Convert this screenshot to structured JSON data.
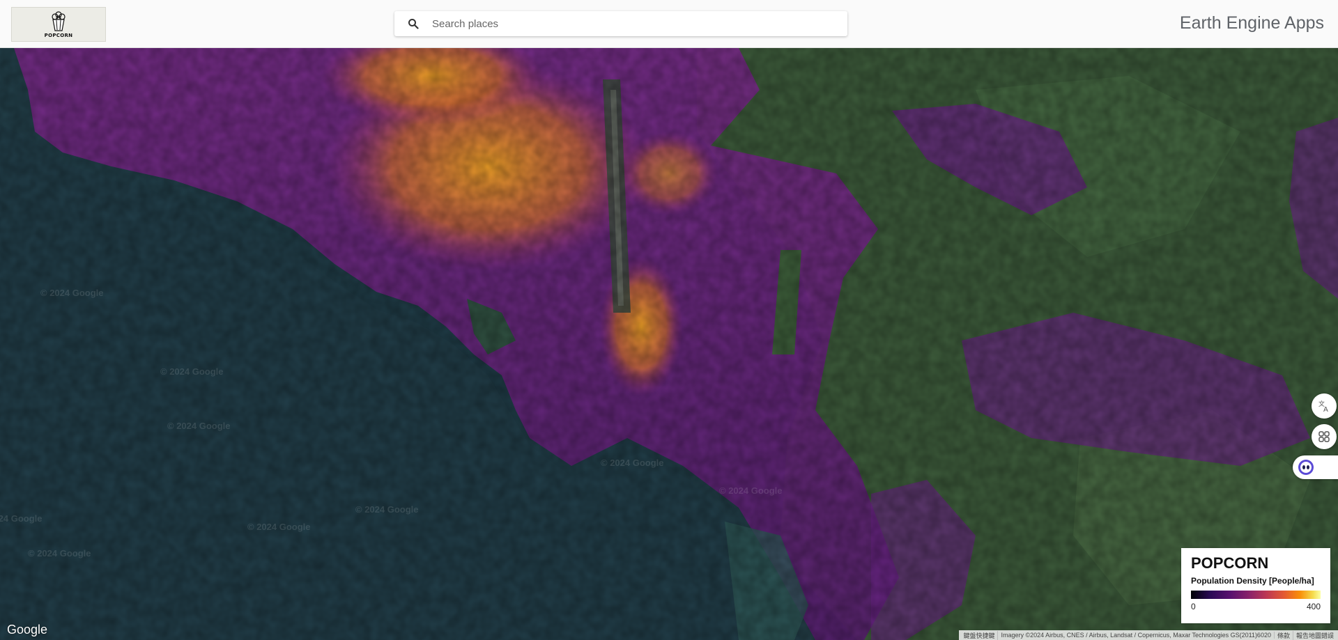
{
  "header": {
    "logo_text": "POPCORN",
    "search": {
      "placeholder": "Search places",
      "value": ""
    },
    "app_title": "Earth Engine Apps"
  },
  "map": {
    "watermark_text": "© 2024 Google",
    "google_logo": "Google",
    "attribution": {
      "keyboard_shortcuts": "鍵盤快捷鍵",
      "imagery": "Imagery ©2024 Airbus, CNES / Airbus, Landsat / Copernicus, Maxar Technologies GS(2011)6020",
      "terms": "條款",
      "report": "報告地圖錯誤"
    },
    "side_buttons": [
      "translate-icon",
      "extensions-icon"
    ],
    "assistant_icon": "assistant-face-icon"
  },
  "legend": {
    "title": "POPCORN",
    "subtitle": "Population Density [People/ha]",
    "min": "0",
    "max": "400",
    "colormap": [
      "#000004",
      "#57106e",
      "#bc3754",
      "#f98e09",
      "#fcffa4"
    ]
  }
}
